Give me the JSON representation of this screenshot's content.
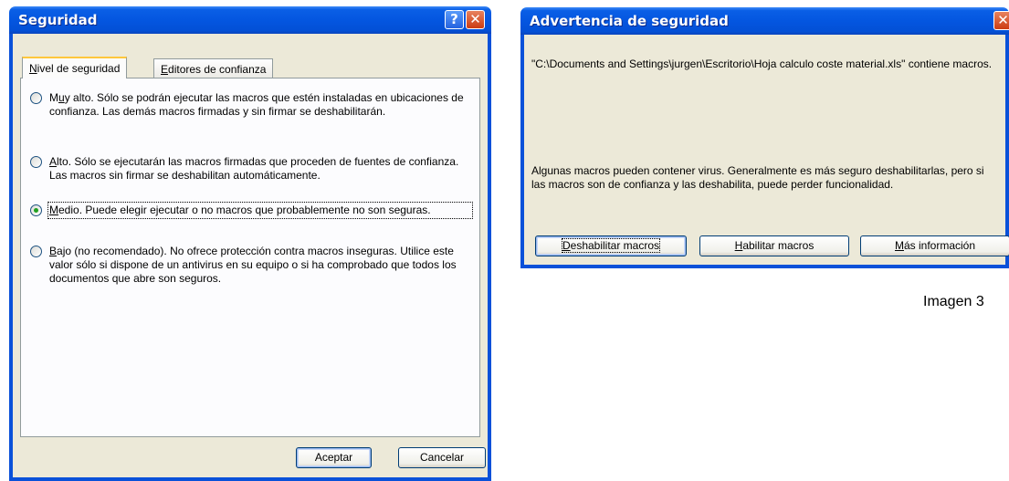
{
  "security_dialog": {
    "title": "Seguridad",
    "help_glyph": "?",
    "close_glyph": "✕",
    "tabs": [
      {
        "label_u": "N",
        "label_rest": "ivel de seguridad"
      },
      {
        "label_u": "E",
        "label_rest": "ditores de confianza"
      }
    ],
    "options": [
      {
        "pre": "M",
        "u": "u",
        "post": "y alto. Sólo se podrán ejecutar las macros que estén instaladas en ubicaciones de confianza. Las demás macros firmadas y sin firmar se deshabilitarán.",
        "checked": false
      },
      {
        "pre": "",
        "u": "A",
        "post": "lto. Sólo se ejecutarán las macros firmadas que proceden de fuentes de confianza. Las macros sin firmar se deshabilitan automáticamente.",
        "checked": false
      },
      {
        "pre": "",
        "u": "M",
        "post": "edio. Puede elegir ejecutar o no macros que probablemente no son seguras.",
        "checked": true
      },
      {
        "pre": "",
        "u": "B",
        "post": "ajo (no recomendado). No ofrece protección contra macros inseguras. Utilice este valor sólo si dispone de un antivirus en su equipo o si ha comprobado que todos los documentos que abre son seguros.",
        "checked": false
      }
    ],
    "ok_label": "Aceptar",
    "cancel_label": "Cancelar"
  },
  "warning_dialog": {
    "title": "Advertencia de seguridad",
    "close_glyph": "✕",
    "file_message": "\"C:\\Documents and Settings\\jurgen\\Escritorio\\Hoja calculo coste material.xls\" contiene macros.",
    "virus_message": "Algunas macros pueden contener virus. Generalmente es más seguro deshabilitarlas, pero si las macros son de confianza y las deshabilita, puede perder funcionalidad.",
    "buttons": [
      {
        "u": "D",
        "rest": "eshabilitar macros"
      },
      {
        "u": "H",
        "rest": "abilitar macros"
      },
      {
        "u": "M",
        "rest": "ás información"
      }
    ]
  },
  "caption": "Imagen 3",
  "colors": {
    "titlebar": "#0456e0",
    "window_face": "#ece9d8",
    "close_button": "#cc3c12",
    "radio_dot": "#21a121"
  }
}
